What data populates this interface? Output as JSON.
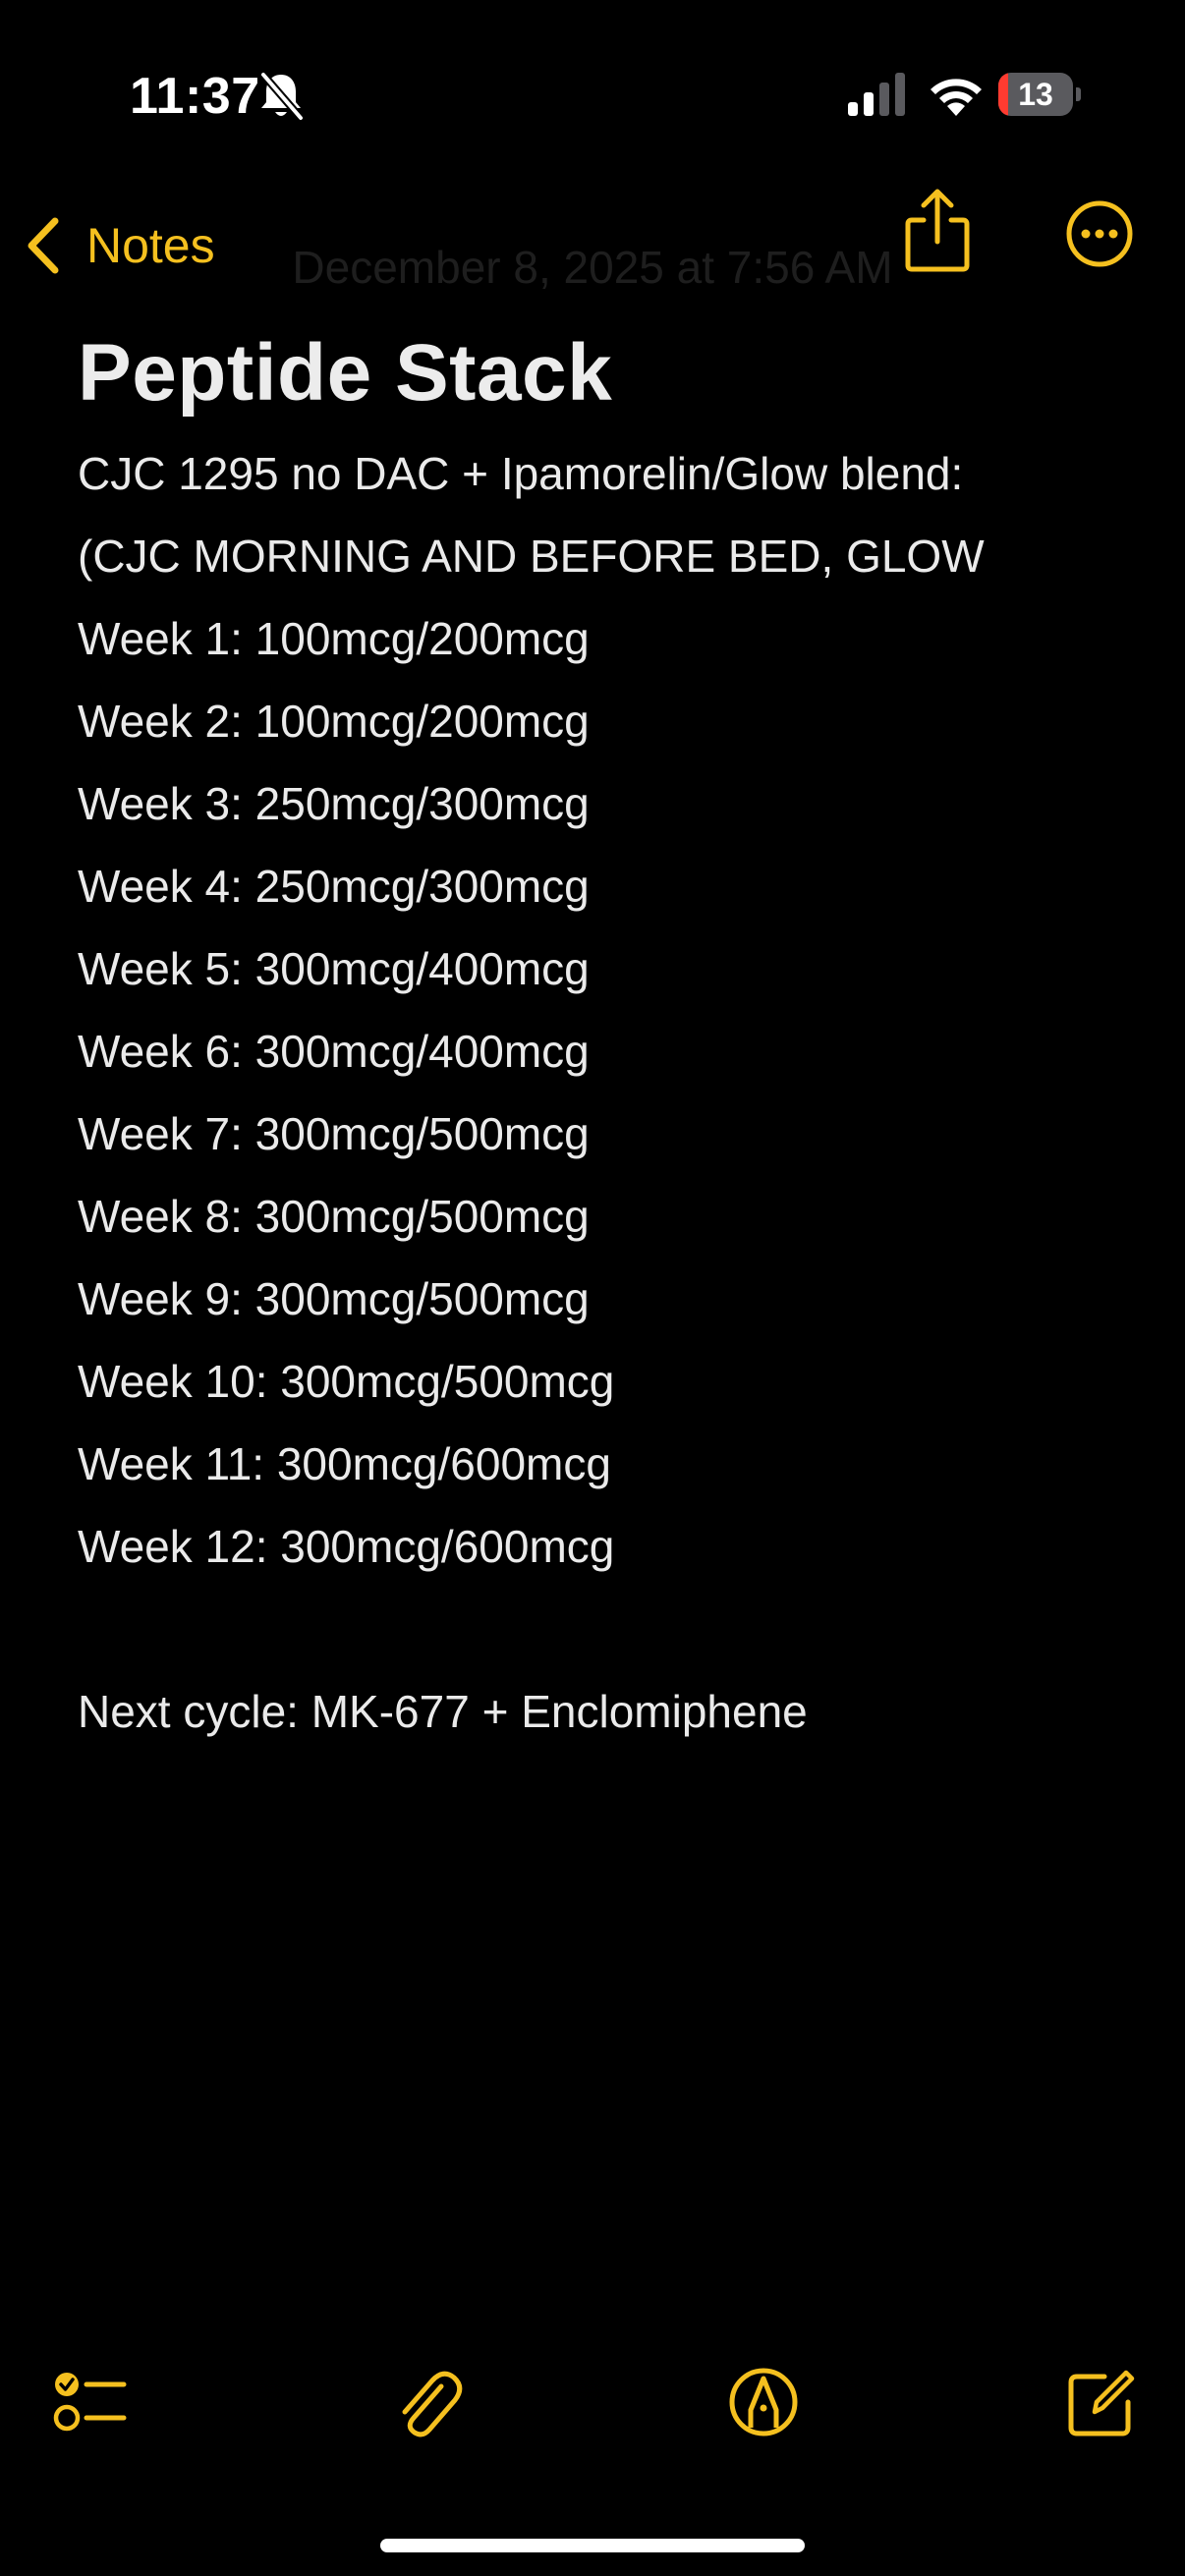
{
  "status_bar": {
    "time": "11:37",
    "battery_level": "13",
    "battery_fraction": 0.13,
    "battery_color": "#ff3b30"
  },
  "nav": {
    "back_label": "Notes",
    "faded_date": "December 8, 2025 at 7:56 AM",
    "accent_color": "#f5c01f",
    "icons": [
      "chevron-left-icon",
      "share-icon",
      "more-icon"
    ]
  },
  "note": {
    "title": "Peptide Stack",
    "header_lines": [
      "CJC 1295 no DAC + Ipamorelin/Glow blend:",
      "(CJC MORNING AND BEFORE BED, GLOW"
    ],
    "weeks": [
      "Week 1: 100mcg/200mcg",
      "Week 2: 100mcg/200mcg",
      "Week 3: 250mcg/300mcg",
      "Week 4: 250mcg/300mcg",
      "Week 5: 300mcg/400mcg",
      "Week 6: 300mcg/400mcg",
      "Week 7: 300mcg/500mcg",
      "Week 8: 300mcg/500mcg",
      "Week 9: 300mcg/500mcg",
      "Week 10: 300mcg/500mcg",
      "Week 11: 300mcg/600mcg",
      "Week 12: 300mcg/600mcg"
    ],
    "footer_line": "Next cycle: MK-677 + Enclomiphene"
  },
  "toolbar": {
    "icons": [
      "checklist-icon",
      "paperclip-icon",
      "markup-pen-icon",
      "compose-icon"
    ]
  }
}
